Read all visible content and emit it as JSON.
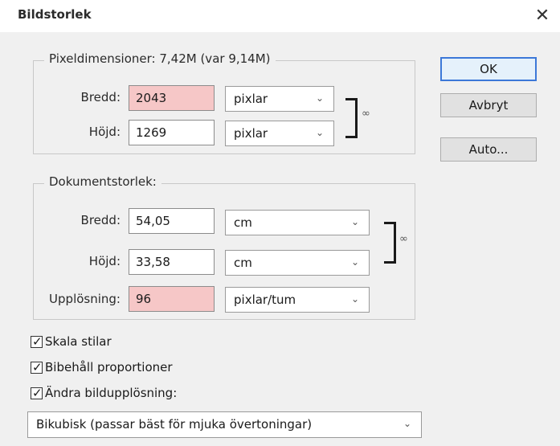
{
  "window": {
    "title": "Bildstorlek",
    "close_glyph": "✕"
  },
  "pixel_dimensions": {
    "legend": "Pixeldimensioner: 7,42M (var 9,14M)",
    "width": {
      "label": "Bredd:",
      "value": "2043",
      "unit": "pixlar"
    },
    "height": {
      "label": "Höjd:",
      "value": "1269",
      "unit": "pixlar"
    }
  },
  "document_size": {
    "legend": "Dokumentstorlek:",
    "width": {
      "label": "Bredd:",
      "value": "54,05",
      "unit": "cm"
    },
    "height": {
      "label": "Höjd:",
      "value": "33,58",
      "unit": "cm"
    },
    "resolution": {
      "label": "Upplösning:",
      "value": "96",
      "unit": "pixlar/tum"
    }
  },
  "buttons": {
    "ok": "OK",
    "cancel": "Avbryt",
    "auto": "Auto..."
  },
  "options": {
    "scale_styles": {
      "label": "Skala stilar",
      "checked": true
    },
    "constrain": {
      "label": "Bibehåll proportioner",
      "checked": true
    },
    "resample": {
      "label": "Ändra bildupplösning:",
      "checked": true
    }
  },
  "resample_method": "Bikubisk (passar bäst för mjuka övertoningar)",
  "colors": {
    "highlight_field": "#f6c7c7",
    "default_button_border": "#3c78d8"
  }
}
